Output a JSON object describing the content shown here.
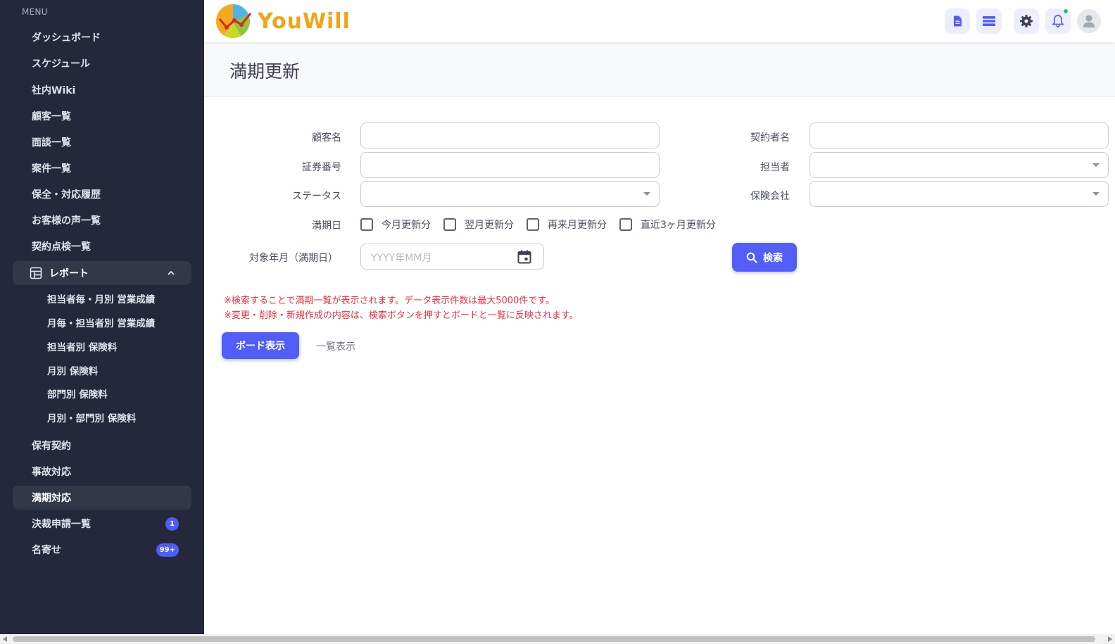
{
  "app": {
    "logo_text": "YouWill"
  },
  "sidebar": {
    "menu_header": "MENU",
    "items": [
      {
        "label": "ダッシュボード"
      },
      {
        "label": "スケジュール"
      },
      {
        "label": "社内Wiki"
      },
      {
        "label": "顧客一覧"
      },
      {
        "label": "面談一覧"
      },
      {
        "label": "案件一覧"
      },
      {
        "label": "保全・対応履歴"
      },
      {
        "label": "お客様の声一覧"
      },
      {
        "label": "契約点検一覧"
      }
    ],
    "report_group": {
      "label": "レポート",
      "subitems": [
        {
          "label": "担当者毎・月別 営業成績"
        },
        {
          "label": "月毎・担当者別 営業成績"
        },
        {
          "label": "担当者別 保険料"
        },
        {
          "label": "月別 保険料"
        },
        {
          "label": "部門別 保険料"
        },
        {
          "label": "月別・部門別 保険料"
        }
      ]
    },
    "bottom_items": [
      {
        "label": "保有契約"
      },
      {
        "label": "事故対応"
      },
      {
        "label": "満期対応",
        "active": true
      },
      {
        "label": "決裁申請一覧",
        "badge": "1"
      },
      {
        "label": "名寄せ",
        "badge": "99+"
      }
    ]
  },
  "page": {
    "title": "満期更新"
  },
  "form": {
    "customer_name_label": "顧客名",
    "contractor_name_label": "契約者名",
    "policy_number_label": "証券番号",
    "assignee_label": "担当者",
    "status_label": "ステータス",
    "insurer_label": "保険会社",
    "maturity_date_label": "満期日",
    "checkboxes": [
      {
        "label": "今月更新分"
      },
      {
        "label": "翌月更新分"
      },
      {
        "label": "再来月更新分"
      },
      {
        "label": "直近3ヶ月更新分"
      }
    ],
    "target_month_label": "対象年月（満期日）",
    "target_month_placeholder": "YYYY年MM月",
    "search_label": "検索"
  },
  "notes": [
    "※検索することで満期一覧が表示されます。データ表示件数は最大5000件です。",
    "※変更・削除・新規作成の内容は、検索ボタンを押すとボードと一覧に反映されます。"
  ],
  "view_tabs": {
    "board": "ボード表示",
    "list": "一覧表示"
  },
  "colors": {
    "sidebar_bg": "#24283a",
    "accent": "#525ef7",
    "note_red": "#e5333f",
    "logo_orange": "#f0a418"
  }
}
